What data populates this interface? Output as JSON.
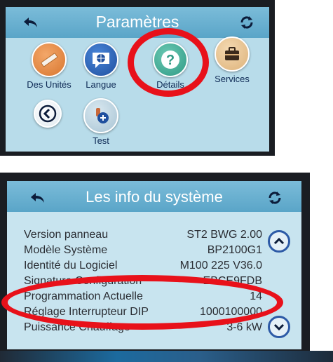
{
  "screen1": {
    "title": "Paramètres",
    "icons": [
      {
        "label": "Des Unités",
        "icon": "ruler-icon"
      },
      {
        "label": "Langue",
        "icon": "globe-chat-icon"
      },
      {
        "label": "Détails",
        "icon": "question-icon"
      },
      {
        "label": "Services",
        "icon": "briefcase-icon"
      },
      {
        "label": "",
        "icon": "chevron-left-icon"
      },
      {
        "label": "Test",
        "icon": "test-icon"
      }
    ]
  },
  "screen2": {
    "title": "Les info du système",
    "rows": [
      {
        "label": "Version panneau",
        "value": "ST2 BWG 2.00"
      },
      {
        "label": "Modèle Système",
        "value": "BP2100G1"
      },
      {
        "label": "Identité du Logiciel",
        "value": "M100 225 V36.0"
      },
      {
        "label": "Signature Configuration",
        "value": "EBCE9FDB"
      },
      {
        "label": "Programmation Actuelle",
        "value": "14"
      },
      {
        "label": "Réglage Interrupteur DIP",
        "value": "1000100000"
      },
      {
        "label": "Puissance Chauffage",
        "value": "3-6 kW"
      }
    ]
  },
  "colors": {
    "header": "#6ab0d2",
    "screen_bg": "#b8dcea",
    "highlight": "#e8111a",
    "scroll_button": "#2d5aa6"
  }
}
